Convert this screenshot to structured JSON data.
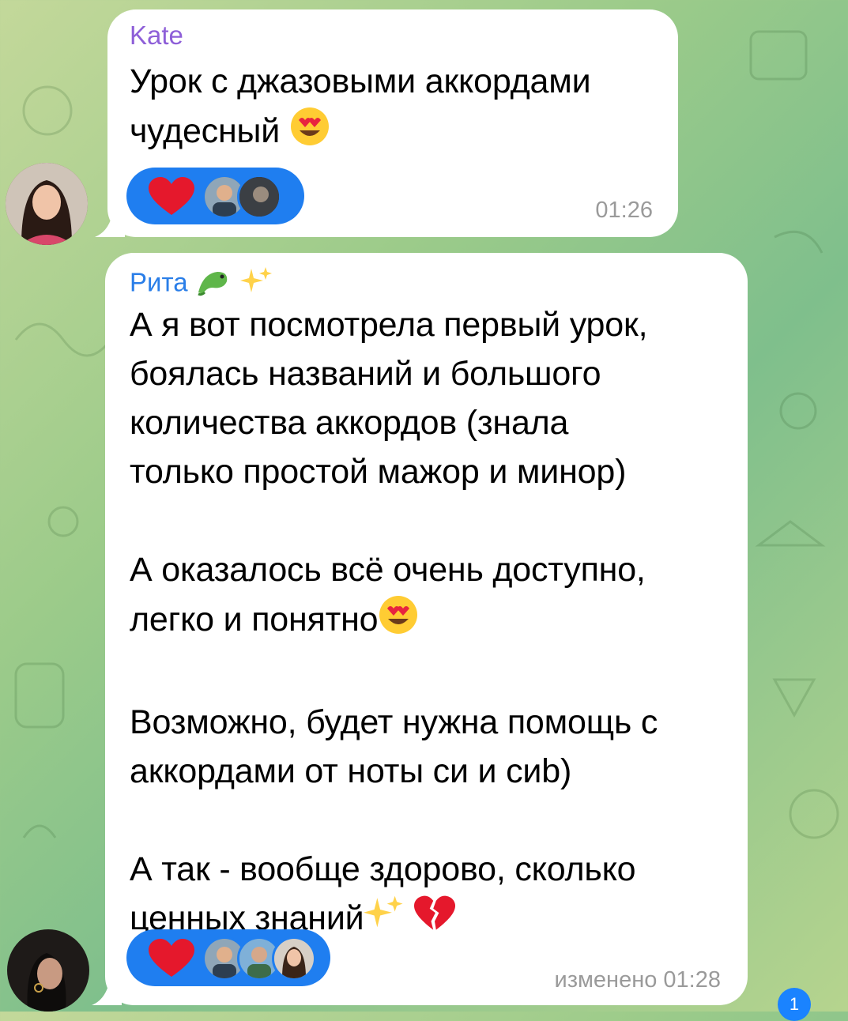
{
  "messages": [
    {
      "sender": "Kate",
      "sender_color": "#8e5fd8",
      "text_before_emoji": "Урок с джазовыми аккордами\nчудесный ",
      "emoji": "heart-eyes-emoji",
      "reaction": "heart",
      "time": "01:26"
    },
    {
      "sender": "Рита",
      "sender_color": "#2a7ee8",
      "sender_emojis": [
        "dragon-emoji",
        "sparkles-emoji"
      ],
      "paragraphs": [
        "А я вот посмотрела первый урок,\nбоялась названий и большого\nколичества аккордов (знала\nтолько простой мажор и минор)",
        "А оказалось всё очень доступно,\nлегко и понятно",
        "Возможно, будет нужна помощь с\nаккордами от ноты си и сиb)",
        "А так - вообще здорово, сколько\nценных знаний"
      ],
      "reaction": "heart",
      "edited_label": "изменено",
      "time": "01:28"
    }
  ],
  "unread_badge": "1",
  "colors": {
    "reaction_bg": "#1f7ef0",
    "bubble_bg": "#ffffff",
    "time_color": "#9a9a9a"
  }
}
